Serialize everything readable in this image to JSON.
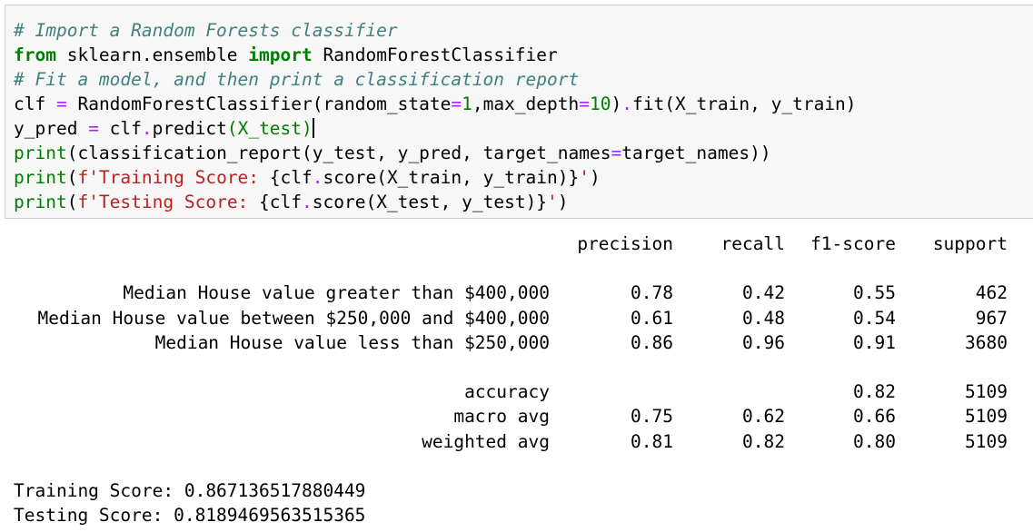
{
  "code_cell": {
    "lines": [
      [
        {
          "t": "# Import a Random Forests classifier",
          "k": "comment"
        }
      ],
      [
        {
          "t": "from",
          "k": "keyword"
        },
        {
          "t": " sklearn.ensemble ",
          "k": "plain"
        },
        {
          "t": "import",
          "k": "keyword"
        },
        {
          "t": " RandomForestClassifier",
          "k": "plain"
        }
      ],
      [
        {
          "t": "# Fit a model, and then print a classification report",
          "k": "comment"
        }
      ],
      [
        {
          "t": "clf ",
          "k": "plain"
        },
        {
          "t": "=",
          "k": "op"
        },
        {
          "t": " RandomForestClassifier(random_state",
          "k": "plain"
        },
        {
          "t": "=",
          "k": "op"
        },
        {
          "t": "1",
          "k": "number"
        },
        {
          "t": ",max_depth",
          "k": "plain"
        },
        {
          "t": "=",
          "k": "op"
        },
        {
          "t": "10",
          "k": "number"
        },
        {
          "t": ")",
          "k": "plain"
        },
        {
          "t": ".",
          "k": "op"
        },
        {
          "t": "fit(X_train, y_train)",
          "k": "plain"
        }
      ],
      [
        {
          "t": "y_pred ",
          "k": "plain"
        },
        {
          "t": "=",
          "k": "op"
        },
        {
          "t": " clf",
          "k": "plain"
        },
        {
          "t": ".",
          "k": "op"
        },
        {
          "t": "predict",
          "k": "plain"
        },
        {
          "t": "(X_test)",
          "k": "builtin"
        },
        {
          "t": "",
          "k": "cursor"
        }
      ],
      [
        {
          "t": "print",
          "k": "builtin"
        },
        {
          "t": "(classification_report(y_test, y_pred, target_names",
          "k": "plain"
        },
        {
          "t": "=",
          "k": "op"
        },
        {
          "t": "target_names))",
          "k": "plain"
        }
      ],
      [
        {
          "t": "print",
          "k": "builtin"
        },
        {
          "t": "(",
          "k": "plain"
        },
        {
          "t": "f'Training Score: ",
          "k": "string"
        },
        {
          "t": "{clf",
          "k": "plain"
        },
        {
          "t": ".",
          "k": "op"
        },
        {
          "t": "score(X_train, y_train)}",
          "k": "plain"
        },
        {
          "t": "'",
          "k": "string"
        },
        {
          "t": ")",
          "k": "plain"
        }
      ],
      [
        {
          "t": "print",
          "k": "builtin"
        },
        {
          "t": "(",
          "k": "plain"
        },
        {
          "t": "f'Testing Score: ",
          "k": "string"
        },
        {
          "t": "{clf",
          "k": "plain"
        },
        {
          "t": ".",
          "k": "op"
        },
        {
          "t": "score(X_test, y_test)}",
          "k": "plain"
        },
        {
          "t": "'",
          "k": "string"
        },
        {
          "t": ")",
          "k": "plain"
        }
      ]
    ]
  },
  "report": {
    "header": {
      "label": "",
      "precision": "precision",
      "recall": "recall",
      "f1": "f1-score",
      "support": "support"
    },
    "class_rows": [
      {
        "label": "Median House value greater than $400,000",
        "precision": "0.78",
        "recall": "0.42",
        "f1": "0.55",
        "support": "462"
      },
      {
        "label": "Median House value between $250,000 and $400,000",
        "precision": "0.61",
        "recall": "0.48",
        "f1": "0.54",
        "support": "967"
      },
      {
        "label": "Median House value less than $250,000",
        "precision": "0.86",
        "recall": "0.96",
        "f1": "0.91",
        "support": "3680"
      }
    ],
    "summary_rows": [
      {
        "label": "accuracy",
        "precision": "",
        "recall": "",
        "f1": "0.82",
        "support": "5109"
      },
      {
        "label": "macro avg",
        "precision": "0.75",
        "recall": "0.62",
        "f1": "0.66",
        "support": "5109"
      },
      {
        "label": "weighted avg",
        "precision": "0.81",
        "recall": "0.82",
        "f1": "0.80",
        "support": "5109"
      }
    ]
  },
  "scores": {
    "training": "Training Score: 0.867136517880449",
    "testing": "Testing Score: 0.8189469563515365"
  },
  "colors": {
    "comment": "#408080",
    "keyword": "#008000",
    "builtin": "#008000",
    "number": "#008000",
    "operator": "#aa22ff",
    "string": "#ba2121",
    "cell_background": "#f7f7f7",
    "cell_border": "#cfcfcf"
  }
}
